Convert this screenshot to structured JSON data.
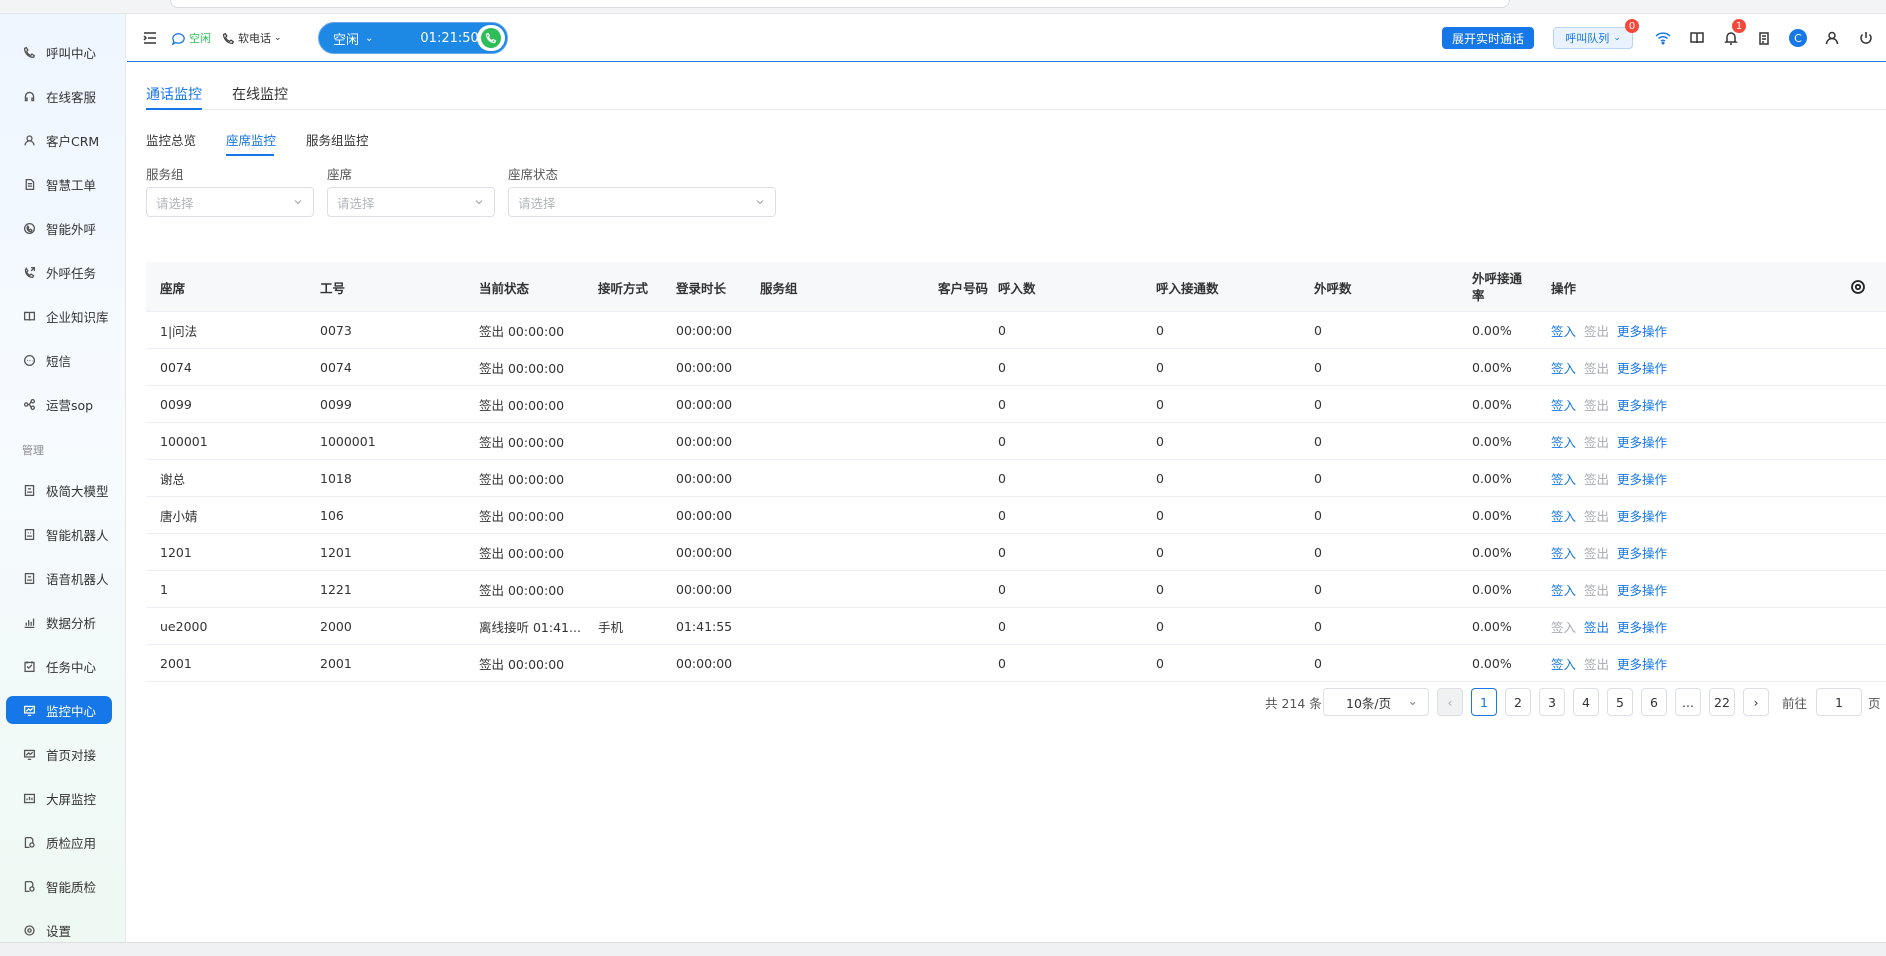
{
  "sidebar": {
    "items": [
      {
        "label": "呼叫中心",
        "icon": "phone-icon"
      },
      {
        "label": "在线客服",
        "icon": "headset-icon"
      },
      {
        "label": "客户CRM",
        "icon": "user-icon"
      },
      {
        "label": "智慧工单",
        "icon": "document-icon"
      },
      {
        "label": "智能外呼",
        "icon": "chat-phone-icon"
      },
      {
        "label": "外呼任务",
        "icon": "phone-outgoing-icon"
      },
      {
        "label": "企业知识库",
        "icon": "book-icon"
      },
      {
        "label": "短信",
        "icon": "sms-icon"
      },
      {
        "label": "运营sop",
        "icon": "flow-icon"
      }
    ],
    "section_label": "管理",
    "items2": [
      {
        "label": "极简大模型",
        "icon": "model-icon"
      },
      {
        "label": "智能机器人",
        "icon": "robot-icon"
      },
      {
        "label": "语音机器人",
        "icon": "voice-robot-icon"
      },
      {
        "label": "数据分析",
        "icon": "chart-icon"
      },
      {
        "label": "任务中心",
        "icon": "task-icon"
      },
      {
        "label": "监控中心",
        "icon": "monitor-icon",
        "active": true
      },
      {
        "label": "首页对接",
        "icon": "dashboard-icon"
      },
      {
        "label": "大屏监控",
        "icon": "screen-icon"
      },
      {
        "label": "质检应用",
        "icon": "inspect-icon"
      },
      {
        "label": "智能质检",
        "icon": "smart-inspect-icon"
      },
      {
        "label": "设置",
        "icon": "gear-icon"
      }
    ]
  },
  "header": {
    "status_text": "空闲",
    "phone_type": "软电话",
    "call_status": "空闲",
    "call_timer": "01:21:50",
    "realtime_button": "展开实时通话",
    "queue_label": "呼叫队列",
    "queue_badge": "0",
    "notify_badge": "1",
    "avatar_letter": "C",
    "accent": "#1677e8"
  },
  "tabs": [
    "通话监控",
    "在线监控"
  ],
  "subtabs": [
    "监控总览",
    "座席监控",
    "服务组监控"
  ],
  "filters": [
    {
      "label": "服务组",
      "placeholder": "请选择"
    },
    {
      "label": "座席",
      "placeholder": "请选择"
    },
    {
      "label": "座席状态",
      "placeholder": "请选择"
    }
  ],
  "table": {
    "columns": [
      "座席",
      "工号",
      "当前状态",
      "接听方式",
      "登录时长",
      "服务组",
      "客户号码",
      "呼入数",
      "呼入接通数",
      "外呼数",
      "外呼接通率",
      "操作"
    ],
    "rows": [
      [
        "1|问法",
        "0073",
        "签出 00:00:00",
        "",
        "00:00:00",
        "",
        "",
        "0",
        "0",
        "0",
        "0",
        "0.00%"
      ],
      [
        "0074",
        "0074",
        "签出 00:00:00",
        "",
        "00:00:00",
        "",
        "",
        "0",
        "0",
        "0",
        "0",
        "0.00%"
      ],
      [
        "0099",
        "0099",
        "签出 00:00:00",
        "",
        "00:00:00",
        "",
        "",
        "0",
        "0",
        "0",
        "0",
        "0.00%"
      ],
      [
        "100001",
        "1000001",
        "签出 00:00:00",
        "",
        "00:00:00",
        "",
        "",
        "0",
        "0",
        "0",
        "0",
        "0.00%"
      ],
      [
        "谢总",
        "1018",
        "签出 00:00:00",
        "",
        "00:00:00",
        "",
        "",
        "0",
        "0",
        "0",
        "0",
        "0.00%"
      ],
      [
        "唐小婧",
        "106",
        "签出 00:00:00",
        "",
        "00:00:00",
        "",
        "",
        "0",
        "0",
        "0",
        "0",
        "0.00%"
      ],
      [
        "1201",
        "1201",
        "签出 00:00:00",
        "",
        "00:00:00",
        "",
        "",
        "0",
        "0",
        "0",
        "0",
        "0.00%"
      ],
      [
        "1",
        "1221",
        "签出 00:00:00",
        "",
        "00:00:00",
        "",
        "",
        "0",
        "0",
        "0",
        "0",
        "0.00%"
      ],
      [
        "ue2000",
        "2000",
        "离线接听 01:41...",
        "手机",
        "01:41:55",
        "",
        "",
        "0",
        "0",
        "0",
        "0",
        "0.00%"
      ],
      [
        "2001",
        "2001",
        "签出 00:00:00",
        "",
        "00:00:00",
        "",
        "",
        "0",
        "0",
        "0",
        "0",
        "0.00%"
      ]
    ],
    "row_ops": [
      {
        "signin_active": true
      },
      {
        "signin_active": true
      },
      {
        "signin_active": true
      },
      {
        "signin_active": true
      },
      {
        "signin_active": true
      },
      {
        "signin_active": true
      },
      {
        "signin_active": true
      },
      {
        "signin_active": true
      },
      {
        "signin_active": false
      },
      {
        "signin_active": true
      }
    ],
    "op_signin": "签入",
    "op_signout": "签出",
    "op_more": "更多操作"
  },
  "pagination": {
    "total_text": "共 214 条",
    "page_size": "10条/页",
    "pages": [
      "1",
      "2",
      "3",
      "4",
      "5",
      "6",
      "...",
      "22"
    ],
    "current": "1",
    "goto_label": "前往",
    "goto_value": "1",
    "page_unit": "页"
  }
}
